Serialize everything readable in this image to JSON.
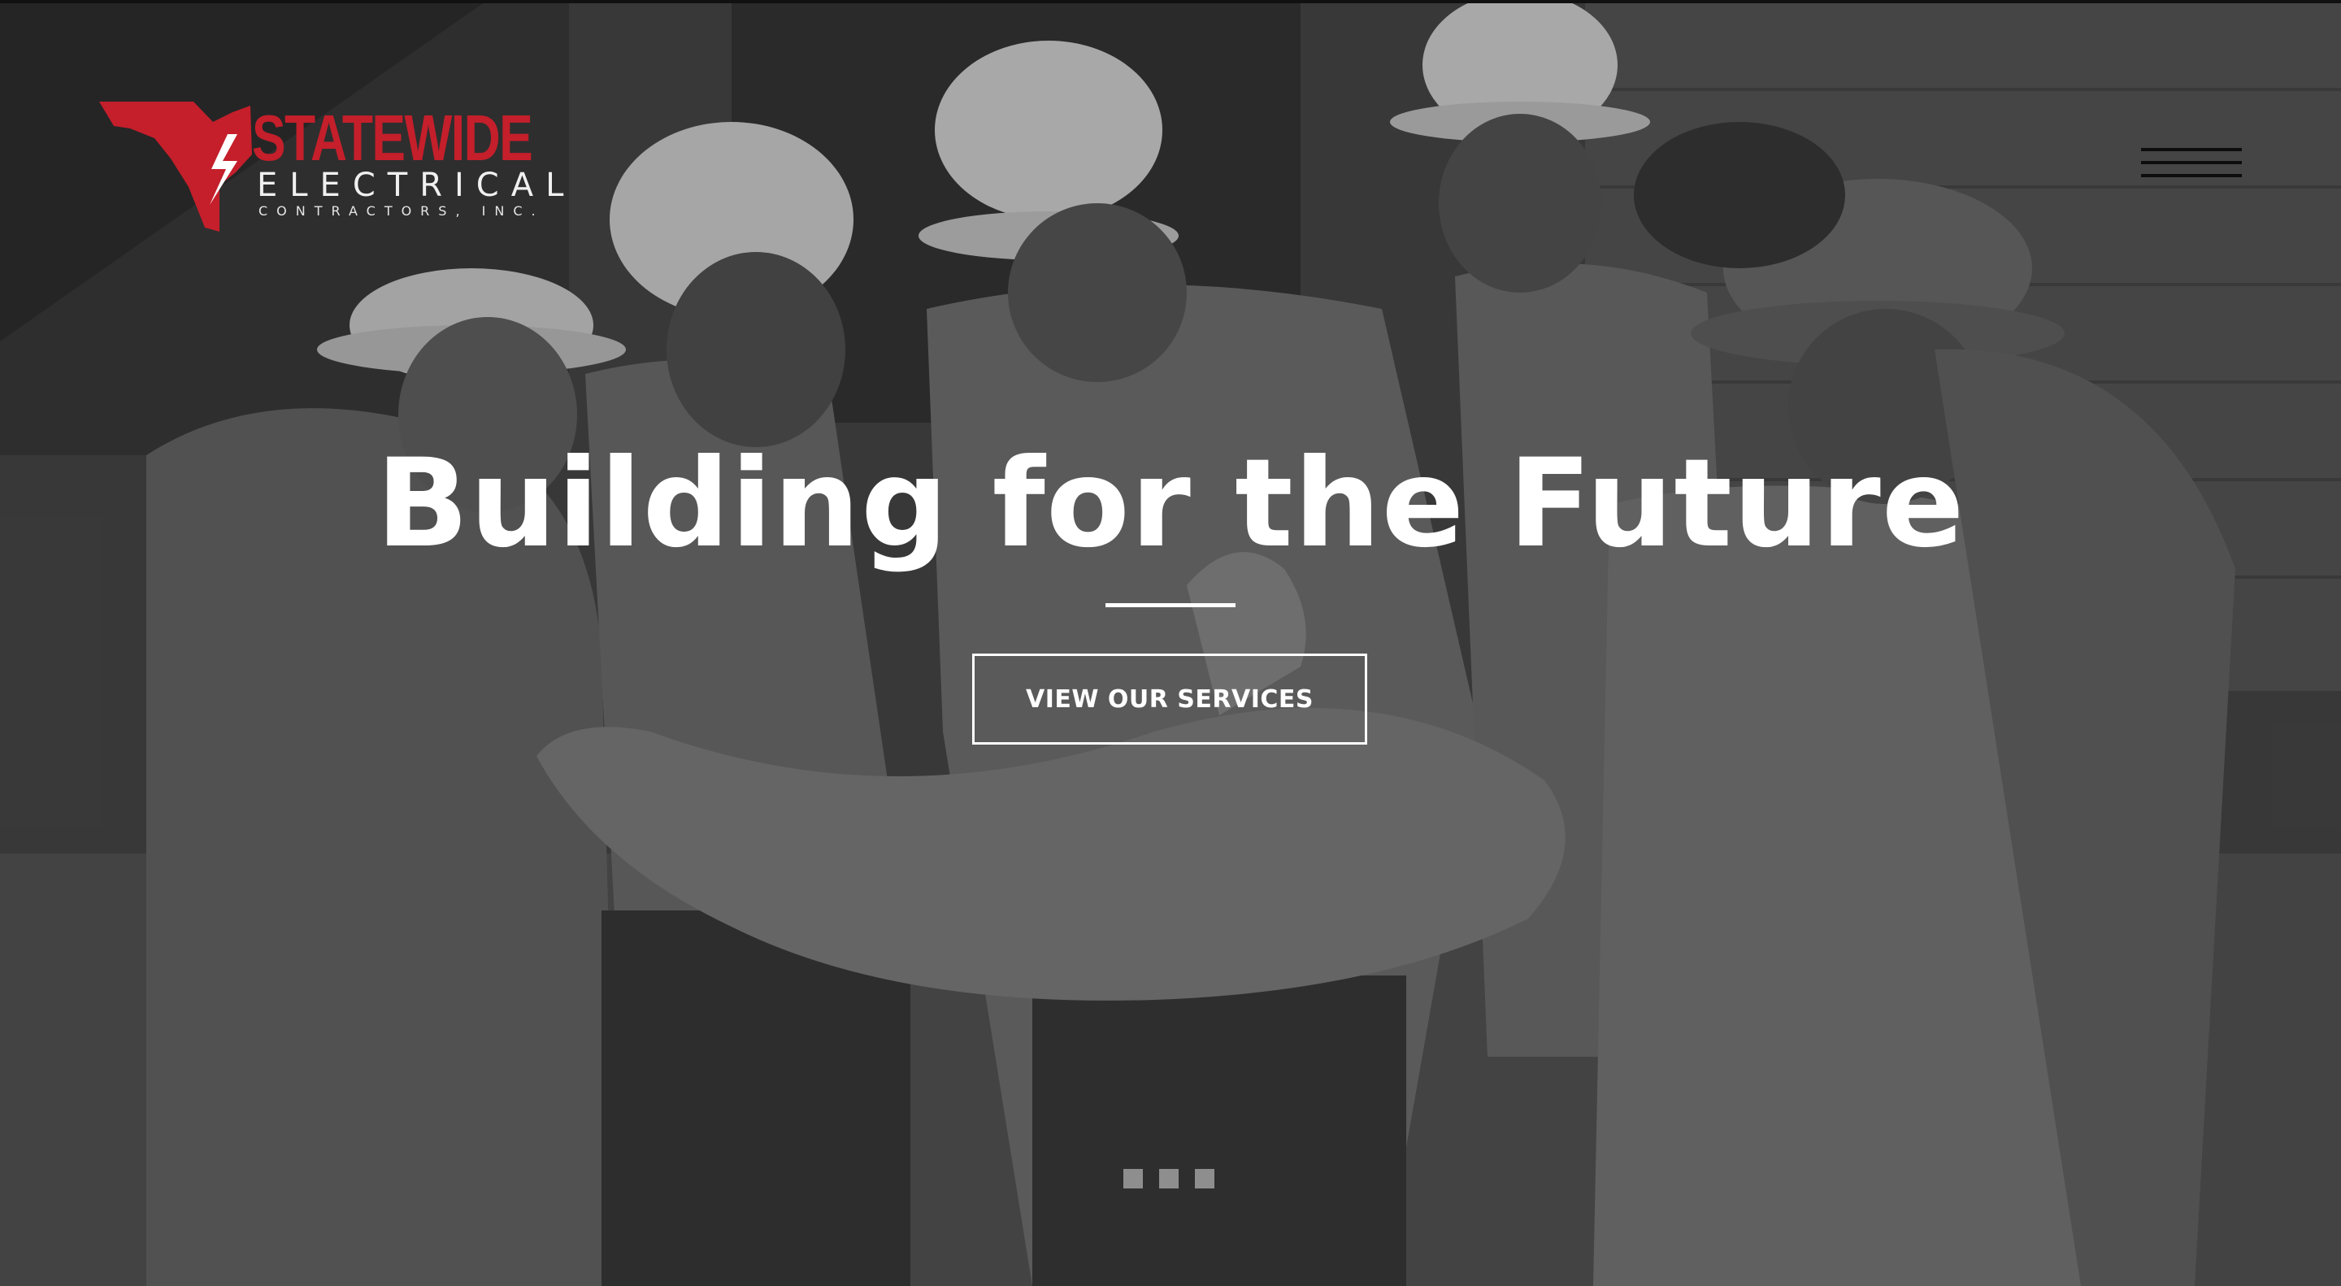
{
  "logo": {
    "brand": "STATEWIDE",
    "line2": "ELECTRICAL",
    "line3": "CONTRACTORS, INC.",
    "brand_color": "#c41f2b",
    "icon": "florida-bolt-icon"
  },
  "nav": {
    "menu_icon": "hamburger-menu-icon"
  },
  "hero": {
    "headline": "Building for the Future",
    "cta_label": "VIEW OUR SERVICES",
    "slides": [
      "slide-1",
      "slide-2",
      "slide-3"
    ],
    "active_slide": 1
  },
  "colors": {
    "text": "#ffffff",
    "dot": "#8e8e8e"
  }
}
